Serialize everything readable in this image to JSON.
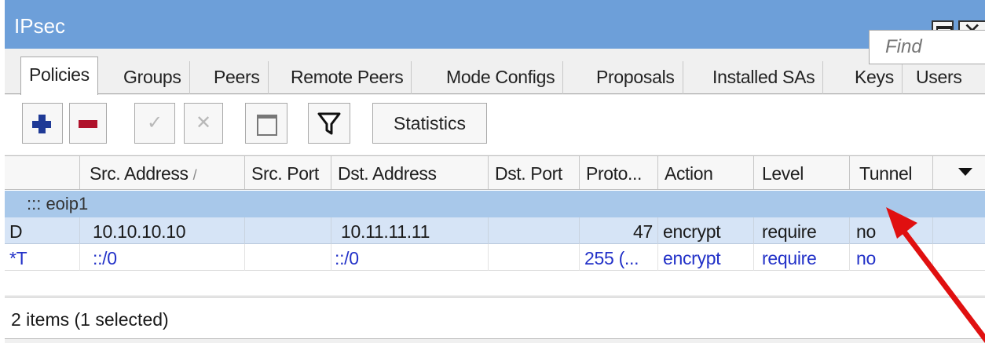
{
  "window": {
    "title": "IPsec"
  },
  "tabs": [
    "Policies",
    "Groups",
    "Peers",
    "Remote Peers",
    "Mode Configs",
    "Proposals",
    "Installed SAs",
    "Keys",
    "Users"
  ],
  "toolbar": {
    "add_icon": "plus-icon",
    "remove_icon": "minus-icon",
    "enable_icon": "check-icon",
    "disable_icon": "cross-icon",
    "comment_icon": "note-icon",
    "filter_icon": "filter-icon",
    "statistics_label": "Statistics",
    "find_placeholder": "Find"
  },
  "table": {
    "columns": [
      "Src. Address",
      "Src. Port",
      "Dst. Address",
      "Dst. Port",
      "Proto...",
      "Action",
      "Level",
      "Tunnel"
    ],
    "sort_indicator": "/",
    "comment": "::: eoip1",
    "rows": [
      {
        "flags": "D",
        "src_address": "10.10.10.10",
        "src_port": "",
        "dst_address": "10.11.11.11",
        "dst_port": "",
        "protocol": "47",
        "action": "encrypt",
        "level": "require",
        "tunnel": "no"
      },
      {
        "flags": "*T",
        "src_address": "::/0",
        "src_port": "",
        "dst_address": "::/0",
        "dst_port": "",
        "protocol": "255 (...",
        "action": "encrypt",
        "level": "require",
        "tunnel": "no"
      }
    ]
  },
  "status": {
    "text": "2 items (1 selected)"
  },
  "colors": {
    "titlebar": "#6d9fd9",
    "selected_row": "#d6e4f6",
    "comment_row": "#a8c8ea",
    "arrow": "#e01010",
    "row_blue_text": "#2231c8"
  }
}
